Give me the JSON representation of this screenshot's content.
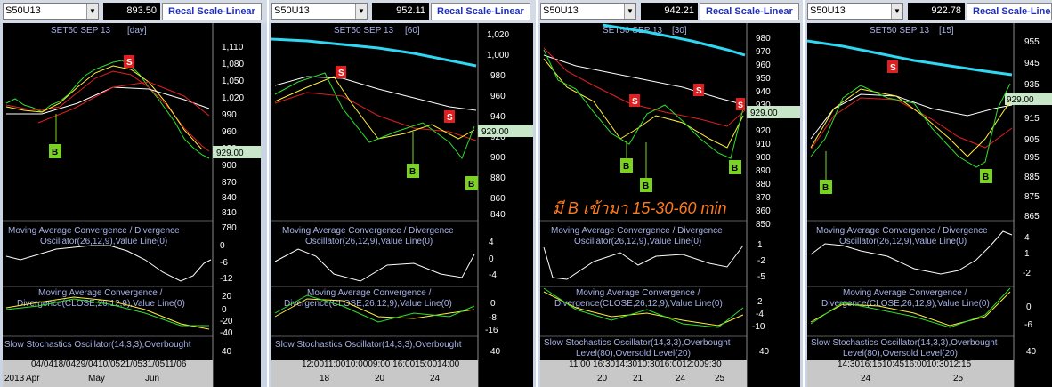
{
  "colors": {
    "accent_blue": "#1f2fb8",
    "sell": "#e02020",
    "buy": "#7bd321",
    "cyan_ma": "#2fd7f2",
    "price_tag": "#c8e6c8"
  },
  "panels": [
    {
      "symbol": "S50U13",
      "price": "893.50",
      "scale_label": "Recal Scale-Linear",
      "title": "SET50 SEP 13",
      "interval": "[day]",
      "price_axis": [
        "1,110",
        "1,080",
        "1,050",
        "1,020",
        "990",
        "960",
        "930",
        "900",
        "870",
        "840",
        "810",
        "780"
      ],
      "last_price_tag": "929.00",
      "macd1_label1": "Moving Average Convergence / Divergence",
      "macd1_label2": "Oscillator(26,12,9),Value Line(0)",
      "macd1_axis": [
        "0",
        "-6",
        "-12"
      ],
      "macd2_label1": "Moving Average Convergence /",
      "macd2_label2": "Divergence(CLOSE,26,12,9),Value Line(0)",
      "macd2_axis": [
        "20",
        "0",
        "-20",
        "-40"
      ],
      "stoch_label": "Slow Stochastics Oscillator(14,3,3),Overbought",
      "stoch_axis": [
        "40"
      ],
      "time_top": "04/0418/0429/0410/0521/0531/0511/06",
      "time_bottom": [
        "2013",
        "Apr",
        "May",
        "Jun"
      ],
      "signals": [
        {
          "text": "S"
        },
        {
          "text": "B"
        }
      ]
    },
    {
      "symbol": "S50U13",
      "price": "952.11",
      "scale_label": "Recal Scale-Linear",
      "title": "SET50 SEP 13",
      "interval": "[60]",
      "price_axis": [
        "1,020",
        "1,000",
        "980",
        "960",
        "940",
        "920",
        "900",
        "880",
        "860",
        "840"
      ],
      "last_price_tag": "929.00",
      "macd1_label1": "Moving Average Convergence / Divergence",
      "macd1_label2": "Oscillator(26,12,9),Value Line(0)",
      "macd1_axis": [
        "4",
        "0",
        "-4"
      ],
      "macd2_label1": "Moving Average Convergence /",
      "macd2_label2": "Divergence(CLOSE,26,12,9),Value Line(0)",
      "macd2_axis": [
        "0",
        "-8",
        "-16"
      ],
      "stoch_label": "Slow Stochastics Oscillator(14,3,3),Overbought",
      "stoch_axis": [
        "40"
      ],
      "time_top": "12:0011:0010:0009:00 16:0015:0014:00",
      "time_bottom": [
        "18",
        "20",
        "24"
      ],
      "signals": [
        {
          "text": "S"
        },
        {
          "text": "S"
        },
        {
          "text": "B"
        },
        {
          "text": "B"
        }
      ]
    },
    {
      "symbol": "S50U13",
      "price": "942.21",
      "scale_label": "Recal Scale-Linear",
      "title": "SET50 SEP 13",
      "interval": "[30]",
      "price_axis": [
        "980",
        "970",
        "960",
        "950",
        "940",
        "930",
        "920",
        "910",
        "900",
        "890",
        "880",
        "870",
        "860",
        "850"
      ],
      "last_price_tag": "929.00",
      "overlay_text": "มี B เข้ามา 15-30-60 min",
      "macd1_label1": "Moving Average Convergence / Divergence",
      "macd1_label2": "Oscillator(26,12,9),Value Line(0)",
      "macd1_axis": [
        "1",
        "-2",
        "-5"
      ],
      "macd2_label1": "Moving Average Convergence /",
      "macd2_label2": "Divergence(CLOSE,26,12,9),Value Line(0)",
      "macd2_axis": [
        "2",
        "-4",
        "-10"
      ],
      "stoch_label": "Slow Stochastics Oscillator(14,3,3),Overbought",
      "stoch_label2": "Level(80),Oversold Level(20)",
      "stoch_axis": [
        "40"
      ],
      "time_top": "11:00 16:3014:3010:3016:0012:009:30",
      "time_bottom": [
        "20",
        "21",
        "24",
        "25"
      ],
      "signals": [
        {
          "text": "S"
        },
        {
          "text": "S"
        },
        {
          "text": "S"
        },
        {
          "text": "B"
        },
        {
          "text": "B"
        },
        {
          "text": "B"
        }
      ]
    },
    {
      "symbol": "S50U13",
      "price": "922.78",
      "scale_label": "Recal Scale-Linear",
      "title": "SET50 SEP 13",
      "interval": "[15]",
      "price_axis": [
        "955",
        "945",
        "935",
        "925",
        "915",
        "905",
        "895",
        "885",
        "875",
        "865"
      ],
      "last_price_tag": "929.00",
      "macd1_label1": "Moving Average Convergence / Divergence",
      "macd1_label2": "Oscillator(26,12,9),Value Line(0)",
      "macd1_axis": [
        "4",
        "1",
        "-2"
      ],
      "macd2_label1": "Moving Average Convergence /",
      "macd2_label2": "Divergence(CLOSE,26,12,9),Value Line(0)",
      "macd2_axis": [
        "0",
        "-6"
      ],
      "stoch_label": "Slow Stochastics Oscillator(14,3,3),Overbought",
      "stoch_label2": "Level(80),Oversold Level(20)",
      "stoch_axis": [
        "40"
      ],
      "time_top": "14:3016:1510:4516:0010:3012:15",
      "time_bottom": [
        "24",
        "25"
      ],
      "signals": [
        {
          "text": "S"
        },
        {
          "text": "B"
        },
        {
          "text": "B"
        }
      ]
    }
  ]
}
